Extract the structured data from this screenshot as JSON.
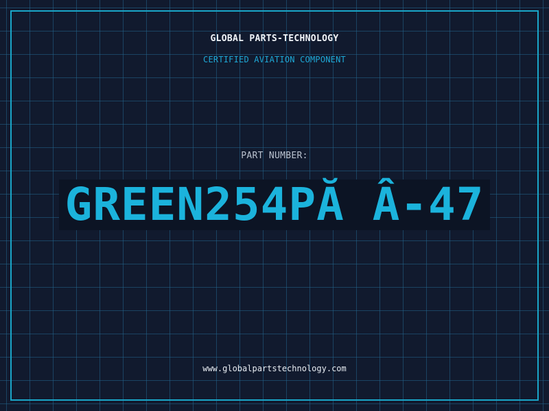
{
  "header": {
    "brand": "GLOBAL PARTS-TECHNOLOGY",
    "subtitle": "CERTIFIED AVIATION COMPONENT"
  },
  "part": {
    "label": "PART NUMBER:",
    "number": "GREEN254PĂ Â-47"
  },
  "footer": {
    "website": "www.globalpartstechnology.com"
  },
  "colors": {
    "background": "#111a2e",
    "grid": "#22648c",
    "frame": "#1aa6c8",
    "accent": "#1bb3dc",
    "brand_text": "#f0f4f8"
  }
}
